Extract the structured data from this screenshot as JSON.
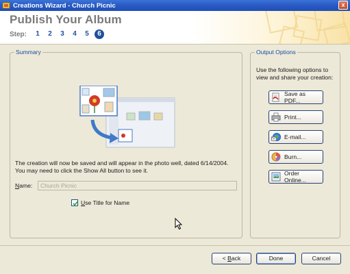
{
  "window": {
    "title": "Creations Wizard - Church Picnic",
    "close_label": "x"
  },
  "header": {
    "title": "Publish Your Album",
    "step_label": "Step:",
    "steps": [
      "1",
      "2",
      "3",
      "4",
      "5",
      "6"
    ],
    "current_step": "6"
  },
  "summary": {
    "legend": "Summary",
    "description_line1": "The creation will now be saved and will appear in the photo well, dated 6/14/2004.",
    "description_line2": "You may need to click the Show All button to see it.",
    "name_label_mnemonic": "N",
    "name_label_rest": "ame:",
    "name_value": "Church Picnic",
    "checkbox_mnemonic": "U",
    "checkbox_rest": "se Title for Name",
    "checkbox_checked": true
  },
  "output": {
    "legend": "Output Options",
    "description": "Use the following options to view and share your creation:",
    "buttons": [
      {
        "label": "Save as PDF...",
        "icon": "pdf-icon"
      },
      {
        "label": "Print...",
        "icon": "printer-icon"
      },
      {
        "label": "E-mail...",
        "icon": "email-icon"
      },
      {
        "label": "Burn...",
        "icon": "cd-icon"
      },
      {
        "label": "Order Online...",
        "icon": "order-online-icon"
      }
    ]
  },
  "footer": {
    "back_prefix": "< ",
    "back_mnemonic": "B",
    "back_rest": "ack",
    "done_label": "Done",
    "cancel_label": "Cancel"
  },
  "colors": {
    "titlebar": "#2a5bc4",
    "accent_blue": "#1f4fa8",
    "window_bg": "#ece9d8"
  }
}
